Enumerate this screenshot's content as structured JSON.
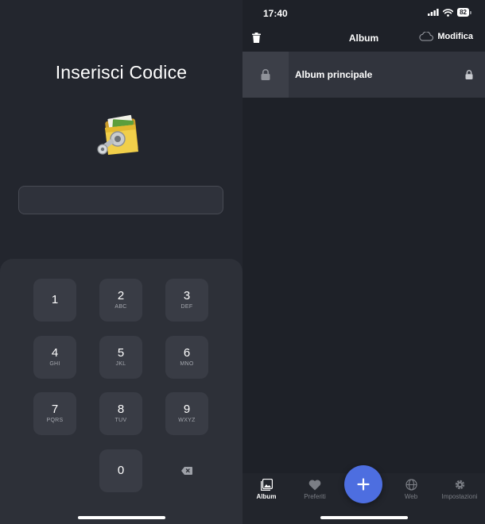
{
  "pin_screen": {
    "title": "Inserisci Codice",
    "icon": "folder-key-icon",
    "code_value": "",
    "keys": [
      {
        "number": "1",
        "letters": ""
      },
      {
        "number": "2",
        "letters": "ABC"
      },
      {
        "number": "3",
        "letters": "DEF"
      },
      {
        "number": "4",
        "letters": "GHI"
      },
      {
        "number": "5",
        "letters": "JKL"
      },
      {
        "number": "6",
        "letters": "MNO"
      },
      {
        "number": "7",
        "letters": "PQRS"
      },
      {
        "number": "8",
        "letters": "TUV"
      },
      {
        "number": "9",
        "letters": "WXYZ"
      },
      {
        "number": "0",
        "letters": ""
      }
    ],
    "delete_icon": "backspace-icon"
  },
  "status_bar": {
    "time": "17:40",
    "battery": "82"
  },
  "album_screen": {
    "nav": {
      "title": "Album",
      "edit_label": "Modifica",
      "trash_icon": "trash-icon",
      "cloud_icon": "cloud-icon"
    },
    "albums": [
      {
        "name": "Album principale",
        "locked": true
      }
    ],
    "tabs": [
      {
        "label": "Album",
        "icon": "album-icon",
        "active": true
      },
      {
        "label": "Preferiti",
        "icon": "heart-icon",
        "active": false
      },
      {
        "label": "Web",
        "icon": "globe-icon",
        "active": false
      },
      {
        "label": "Impostazioni",
        "icon": "gear-icon",
        "active": false
      }
    ],
    "fab_icon": "plus-icon"
  },
  "colors": {
    "background": "#23262e",
    "keypad": "#2d3038",
    "key": "#393c45",
    "accent": "#4d6ee0"
  }
}
